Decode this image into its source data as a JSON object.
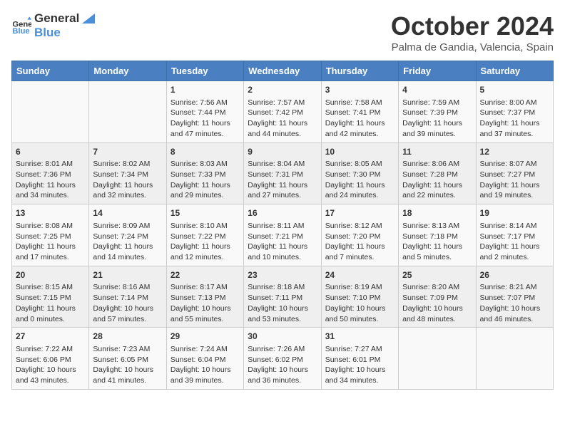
{
  "logo": {
    "line1": "General",
    "line2": "Blue"
  },
  "title": "October 2024",
  "location": "Palma de Gandia, Valencia, Spain",
  "weekdays": [
    "Sunday",
    "Monday",
    "Tuesday",
    "Wednesday",
    "Thursday",
    "Friday",
    "Saturday"
  ],
  "weeks": [
    [
      null,
      null,
      {
        "day": "1",
        "sunrise": "Sunrise: 7:56 AM",
        "sunset": "Sunset: 7:44 PM",
        "daylight": "Daylight: 11 hours and 47 minutes."
      },
      {
        "day": "2",
        "sunrise": "Sunrise: 7:57 AM",
        "sunset": "Sunset: 7:42 PM",
        "daylight": "Daylight: 11 hours and 44 minutes."
      },
      {
        "day": "3",
        "sunrise": "Sunrise: 7:58 AM",
        "sunset": "Sunset: 7:41 PM",
        "daylight": "Daylight: 11 hours and 42 minutes."
      },
      {
        "day": "4",
        "sunrise": "Sunrise: 7:59 AM",
        "sunset": "Sunset: 7:39 PM",
        "daylight": "Daylight: 11 hours and 39 minutes."
      },
      {
        "day": "5",
        "sunrise": "Sunrise: 8:00 AM",
        "sunset": "Sunset: 7:37 PM",
        "daylight": "Daylight: 11 hours and 37 minutes."
      }
    ],
    [
      {
        "day": "6",
        "sunrise": "Sunrise: 8:01 AM",
        "sunset": "Sunset: 7:36 PM",
        "daylight": "Daylight: 11 hours and 34 minutes."
      },
      {
        "day": "7",
        "sunrise": "Sunrise: 8:02 AM",
        "sunset": "Sunset: 7:34 PM",
        "daylight": "Daylight: 11 hours and 32 minutes."
      },
      {
        "day": "8",
        "sunrise": "Sunrise: 8:03 AM",
        "sunset": "Sunset: 7:33 PM",
        "daylight": "Daylight: 11 hours and 29 minutes."
      },
      {
        "day": "9",
        "sunrise": "Sunrise: 8:04 AM",
        "sunset": "Sunset: 7:31 PM",
        "daylight": "Daylight: 11 hours and 27 minutes."
      },
      {
        "day": "10",
        "sunrise": "Sunrise: 8:05 AM",
        "sunset": "Sunset: 7:30 PM",
        "daylight": "Daylight: 11 hours and 24 minutes."
      },
      {
        "day": "11",
        "sunrise": "Sunrise: 8:06 AM",
        "sunset": "Sunset: 7:28 PM",
        "daylight": "Daylight: 11 hours and 22 minutes."
      },
      {
        "day": "12",
        "sunrise": "Sunrise: 8:07 AM",
        "sunset": "Sunset: 7:27 PM",
        "daylight": "Daylight: 11 hours and 19 minutes."
      }
    ],
    [
      {
        "day": "13",
        "sunrise": "Sunrise: 8:08 AM",
        "sunset": "Sunset: 7:25 PM",
        "daylight": "Daylight: 11 hours and 17 minutes."
      },
      {
        "day": "14",
        "sunrise": "Sunrise: 8:09 AM",
        "sunset": "Sunset: 7:24 PM",
        "daylight": "Daylight: 11 hours and 14 minutes."
      },
      {
        "day": "15",
        "sunrise": "Sunrise: 8:10 AM",
        "sunset": "Sunset: 7:22 PM",
        "daylight": "Daylight: 11 hours and 12 minutes."
      },
      {
        "day": "16",
        "sunrise": "Sunrise: 8:11 AM",
        "sunset": "Sunset: 7:21 PM",
        "daylight": "Daylight: 11 hours and 10 minutes."
      },
      {
        "day": "17",
        "sunrise": "Sunrise: 8:12 AM",
        "sunset": "Sunset: 7:20 PM",
        "daylight": "Daylight: 11 hours and 7 minutes."
      },
      {
        "day": "18",
        "sunrise": "Sunrise: 8:13 AM",
        "sunset": "Sunset: 7:18 PM",
        "daylight": "Daylight: 11 hours and 5 minutes."
      },
      {
        "day": "19",
        "sunrise": "Sunrise: 8:14 AM",
        "sunset": "Sunset: 7:17 PM",
        "daylight": "Daylight: 11 hours and 2 minutes."
      }
    ],
    [
      {
        "day": "20",
        "sunrise": "Sunrise: 8:15 AM",
        "sunset": "Sunset: 7:15 PM",
        "daylight": "Daylight: 11 hours and 0 minutes."
      },
      {
        "day": "21",
        "sunrise": "Sunrise: 8:16 AM",
        "sunset": "Sunset: 7:14 PM",
        "daylight": "Daylight: 10 hours and 57 minutes."
      },
      {
        "day": "22",
        "sunrise": "Sunrise: 8:17 AM",
        "sunset": "Sunset: 7:13 PM",
        "daylight": "Daylight: 10 hours and 55 minutes."
      },
      {
        "day": "23",
        "sunrise": "Sunrise: 8:18 AM",
        "sunset": "Sunset: 7:11 PM",
        "daylight": "Daylight: 10 hours and 53 minutes."
      },
      {
        "day": "24",
        "sunrise": "Sunrise: 8:19 AM",
        "sunset": "Sunset: 7:10 PM",
        "daylight": "Daylight: 10 hours and 50 minutes."
      },
      {
        "day": "25",
        "sunrise": "Sunrise: 8:20 AM",
        "sunset": "Sunset: 7:09 PM",
        "daylight": "Daylight: 10 hours and 48 minutes."
      },
      {
        "day": "26",
        "sunrise": "Sunrise: 8:21 AM",
        "sunset": "Sunset: 7:07 PM",
        "daylight": "Daylight: 10 hours and 46 minutes."
      }
    ],
    [
      {
        "day": "27",
        "sunrise": "Sunrise: 7:22 AM",
        "sunset": "Sunset: 6:06 PM",
        "daylight": "Daylight: 10 hours and 43 minutes."
      },
      {
        "day": "28",
        "sunrise": "Sunrise: 7:23 AM",
        "sunset": "Sunset: 6:05 PM",
        "daylight": "Daylight: 10 hours and 41 minutes."
      },
      {
        "day": "29",
        "sunrise": "Sunrise: 7:24 AM",
        "sunset": "Sunset: 6:04 PM",
        "daylight": "Daylight: 10 hours and 39 minutes."
      },
      {
        "day": "30",
        "sunrise": "Sunrise: 7:26 AM",
        "sunset": "Sunset: 6:02 PM",
        "daylight": "Daylight: 10 hours and 36 minutes."
      },
      {
        "day": "31",
        "sunrise": "Sunrise: 7:27 AM",
        "sunset": "Sunset: 6:01 PM",
        "daylight": "Daylight: 10 hours and 34 minutes."
      },
      null,
      null
    ]
  ]
}
